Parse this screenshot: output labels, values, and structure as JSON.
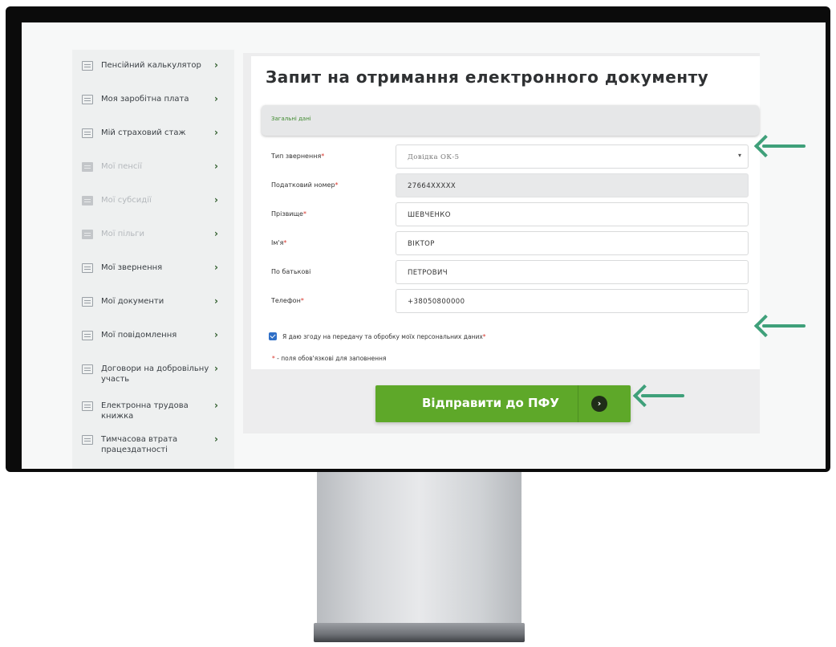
{
  "sidebar": {
    "items": [
      {
        "label": "Пенсійний калькулятор",
        "chevron": "›"
      },
      {
        "label": "Моя заробітна плата",
        "chevron": "›"
      },
      {
        "label": "Мій страховий стаж",
        "chevron": "›"
      },
      {
        "label": "Мої пенсії",
        "chevron": "›"
      },
      {
        "label": "Мої субсидії",
        "chevron": "›"
      },
      {
        "label": "Мої пільги",
        "chevron": "›"
      },
      {
        "label": "Мої звернення",
        "chevron": "›"
      },
      {
        "label": "Мої документи",
        "chevron": "›"
      },
      {
        "label": "Мої повідомлення",
        "chevron": "›"
      },
      {
        "label": "Договори на добровільну участь",
        "chevron": "›"
      },
      {
        "label": "Електронна трудова книжка",
        "chevron": "›"
      },
      {
        "label": "Тимчасова втрата працездатності",
        "chevron": "›"
      }
    ]
  },
  "form": {
    "title": "Запит на отримання електронного документу",
    "section_label": "Загальні дані",
    "required_mark": "*",
    "fields": [
      {
        "label": "Тип звернення",
        "value": "Довідка ОК-5"
      },
      {
        "label": "Податковий номер",
        "value": "27664XXXXX"
      },
      {
        "label": "Прізвище",
        "value": "ШЕВЧЕНКО"
      },
      {
        "label": "Ім'я",
        "value": "ВІКТОР"
      },
      {
        "label": "По батькові",
        "value": "ПЕТРОВИЧ"
      },
      {
        "label": "Телефон",
        "value": "+38050800000"
      }
    ],
    "select_caret": "▾",
    "consent_label": "Я даю згоду на передачу та обробку моїх персональних даних",
    "consent_checked": true,
    "required_note": "- поля обов'язкові для заповнення"
  },
  "submit": {
    "label": "Відправити до ПФУ",
    "icon_glyph": "›"
  },
  "colors": {
    "accent_green": "#5ea829",
    "arrow": "#3fa07a",
    "required": "#d8342a",
    "checkbox": "#2f6fc7"
  }
}
